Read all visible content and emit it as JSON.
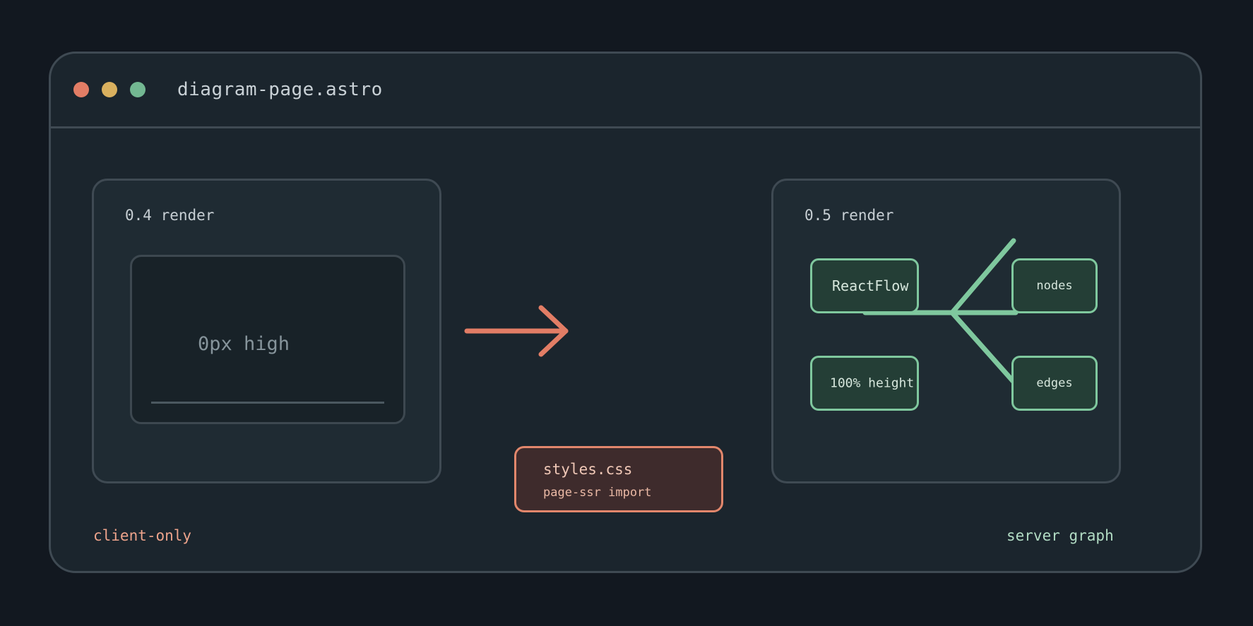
{
  "window": {
    "title": "diagram-page.astro"
  },
  "old_render": {
    "label": "0.4 render",
    "placeholder_text": "0px high"
  },
  "new_render": {
    "label": "0.5 render",
    "nodes": {
      "reactflow": "ReactFlow",
      "nodes": "nodes",
      "edges": "edges",
      "height": "100% height"
    }
  },
  "import_box": {
    "file": "styles.css",
    "note": "page-ssr import"
  },
  "footer": {
    "left": "client-only",
    "right": "server graph"
  },
  "colors": {
    "background": "#121820",
    "window": "#1b252d",
    "border": "#3f4a53",
    "accent_salmon": "#e27d65",
    "accent_green": "#7fc89e",
    "traffic_yellow": "#d9b05e"
  },
  "icons": [
    "window-close-dot",
    "window-minimize-dot",
    "window-maximize-dot",
    "right-arrow-icon"
  ]
}
